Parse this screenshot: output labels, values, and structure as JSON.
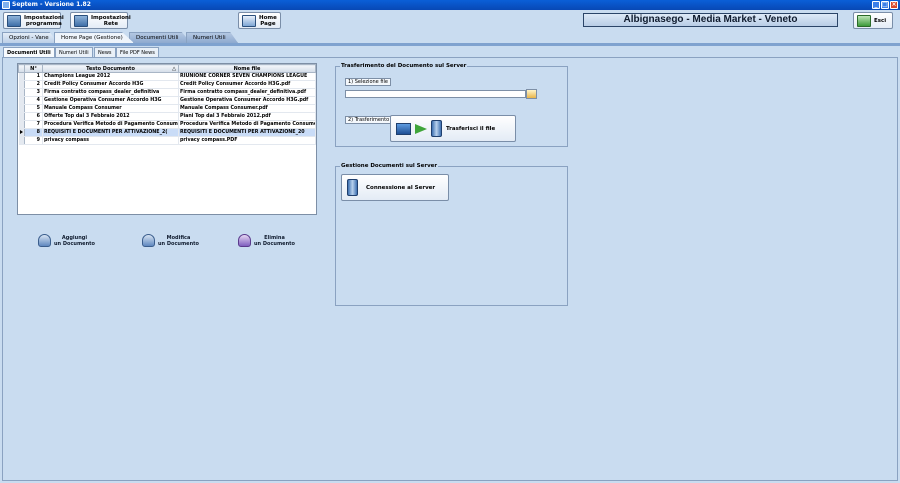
{
  "window": {
    "title": "Septem - Versione 1.82",
    "btn_min": "_",
    "btn_max": "□",
    "btn_close": "×"
  },
  "toolbar": {
    "settings_label": "Impostazioni\nprogramma",
    "network_label": "Impostazioni\nRete",
    "home_label": "Home\nPage",
    "exit_label": "Esci",
    "store_name": "Albignasego - Media Market - Veneto"
  },
  "main_tabs": [
    {
      "label": "Opzioni - Vane"
    },
    {
      "label": "Home Page (Gestione)"
    },
    {
      "label": "Documenti Utili"
    },
    {
      "label": "Numeri Utili"
    }
  ],
  "sub_tabs": [
    {
      "label": "Documenti Utili"
    },
    {
      "label": "Numeri Utili"
    },
    {
      "label": "News"
    },
    {
      "label": "File PDF News"
    }
  ],
  "grid": {
    "col_num": "N°",
    "col_text": "Testo Documento",
    "col_file": "Nome file",
    "sort_glyph": "△",
    "rows": [
      {
        "n": "1",
        "text": "Champions League 2012",
        "file": "RIUNIONE CORNER SEVEN CHAMPIONS LEAGUE"
      },
      {
        "n": "2",
        "text": "Credit Policy Consumer Accordo H3G",
        "file": "Credit Policy Consumer Accordo H3G.pdf"
      },
      {
        "n": "3",
        "text": "Firma contratto compass_dealer_definitiva",
        "file": "Firma contratto compass_dealer_definitiva.pdf"
      },
      {
        "n": "4",
        "text": "Gestione Operativa Consumer Accordo H3G",
        "file": "Gestione Operativa Consumer Accordo H3G.pdf"
      },
      {
        "n": "5",
        "text": "Manuale Compass Consumer",
        "file": "Manuale Compass Consumer.pdf"
      },
      {
        "n": "6",
        "text": "Offerte Top dal 3 Febbraio 2012",
        "file": "Piani Top  dal 3 Febbraio 2012.pdf"
      },
      {
        "n": "7",
        "text": "Procedura Verifica Metodo di Pagamento Consume",
        "file": "Procedura Verifica Metodo di Pagamento Consume"
      },
      {
        "n": "8",
        "text": "REQUISITI E DOCUMENTI PER ATTIVAZIONE_2(",
        "file": "REQUISITI E DOCUMENTI PER ATTIVAZIONE_20"
      },
      {
        "n": "9",
        "text": "privacy compass",
        "file": "privacy compass.PDF"
      }
    ]
  },
  "actions": {
    "add_label": "Aggiungi\nun Documento",
    "edit_label": "Modifica\nun Documento",
    "delete_label": "Elimina\nun Documento"
  },
  "transfer_panel": {
    "title": "Trasferimento del Documento sul Server",
    "select_label": "1) Selezione file",
    "file_value": "",
    "transfer_label": "2) Trasferimento",
    "transfer_button": "Trasferisci il file"
  },
  "server_panel": {
    "title": "Gestione Documenti sul Server",
    "connect_button": "Connessione al Server"
  }
}
